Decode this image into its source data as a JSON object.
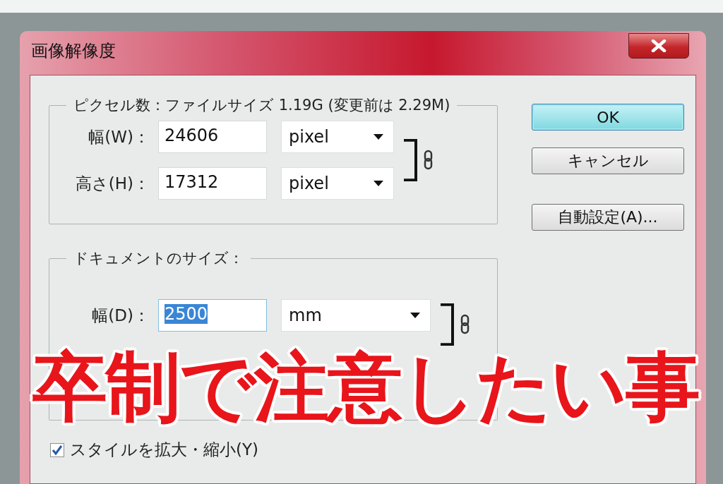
{
  "window": {
    "title": "画像解像度"
  },
  "pixel_dimensions": {
    "legend": "ピクセル数：ファイルサイズ 1.19G (変更前は 2.29M)",
    "linked": true,
    "rows": [
      {
        "kind": "field",
        "label": "幅(W)：",
        "value": "24606",
        "unit": "pixel",
        "selected": false
      },
      {
        "kind": "field",
        "label": "高さ(H)：",
        "value": "17312",
        "unit": "pixel",
        "selected": false
      }
    ]
  },
  "document_size": {
    "legend": "ドキュメントのサイズ：",
    "linked": true,
    "rows": [
      {
        "kind": "field",
        "label": "幅(D)：",
        "value": "2500",
        "unit": "mm",
        "selected": true
      }
    ]
  },
  "buttons": [
    {
      "label": "OK",
      "default": true
    },
    {
      "label": "キャンセル",
      "default": false
    },
    {
      "label": "自動設定(A)...",
      "default": false
    }
  ],
  "checkbox": {
    "label": "スタイルを拡大・縮小(Y)",
    "checked": true
  },
  "caption": "卒制で注意したい事"
}
